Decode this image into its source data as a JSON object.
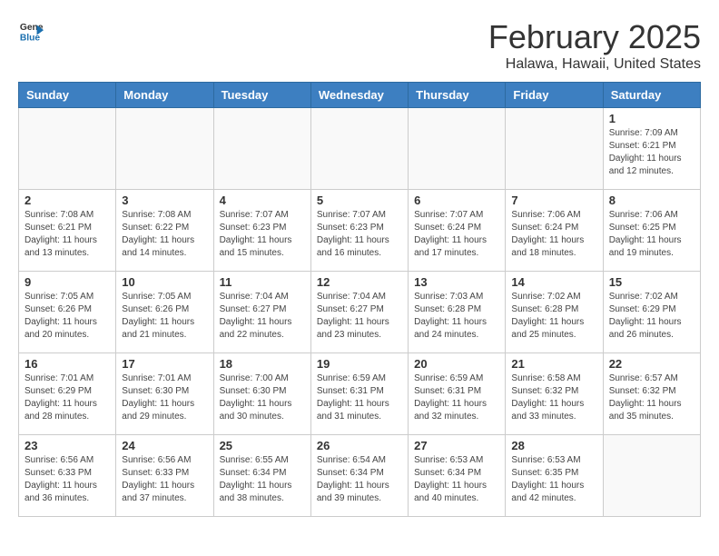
{
  "header": {
    "logo_general": "General",
    "logo_blue": "Blue",
    "title": "February 2025",
    "subtitle": "Halawa, Hawaii, United States"
  },
  "weekdays": [
    "Sunday",
    "Monday",
    "Tuesday",
    "Wednesday",
    "Thursday",
    "Friday",
    "Saturday"
  ],
  "weeks": [
    [
      {
        "day": "",
        "info": ""
      },
      {
        "day": "",
        "info": ""
      },
      {
        "day": "",
        "info": ""
      },
      {
        "day": "",
        "info": ""
      },
      {
        "day": "",
        "info": ""
      },
      {
        "day": "",
        "info": ""
      },
      {
        "day": "1",
        "info": "Sunrise: 7:09 AM\nSunset: 6:21 PM\nDaylight: 11 hours\nand 12 minutes."
      }
    ],
    [
      {
        "day": "2",
        "info": "Sunrise: 7:08 AM\nSunset: 6:21 PM\nDaylight: 11 hours\nand 13 minutes."
      },
      {
        "day": "3",
        "info": "Sunrise: 7:08 AM\nSunset: 6:22 PM\nDaylight: 11 hours\nand 14 minutes."
      },
      {
        "day": "4",
        "info": "Sunrise: 7:07 AM\nSunset: 6:23 PM\nDaylight: 11 hours\nand 15 minutes."
      },
      {
        "day": "5",
        "info": "Sunrise: 7:07 AM\nSunset: 6:23 PM\nDaylight: 11 hours\nand 16 minutes."
      },
      {
        "day": "6",
        "info": "Sunrise: 7:07 AM\nSunset: 6:24 PM\nDaylight: 11 hours\nand 17 minutes."
      },
      {
        "day": "7",
        "info": "Sunrise: 7:06 AM\nSunset: 6:24 PM\nDaylight: 11 hours\nand 18 minutes."
      },
      {
        "day": "8",
        "info": "Sunrise: 7:06 AM\nSunset: 6:25 PM\nDaylight: 11 hours\nand 19 minutes."
      }
    ],
    [
      {
        "day": "9",
        "info": "Sunrise: 7:05 AM\nSunset: 6:26 PM\nDaylight: 11 hours\nand 20 minutes."
      },
      {
        "day": "10",
        "info": "Sunrise: 7:05 AM\nSunset: 6:26 PM\nDaylight: 11 hours\nand 21 minutes."
      },
      {
        "day": "11",
        "info": "Sunrise: 7:04 AM\nSunset: 6:27 PM\nDaylight: 11 hours\nand 22 minutes."
      },
      {
        "day": "12",
        "info": "Sunrise: 7:04 AM\nSunset: 6:27 PM\nDaylight: 11 hours\nand 23 minutes."
      },
      {
        "day": "13",
        "info": "Sunrise: 7:03 AM\nSunset: 6:28 PM\nDaylight: 11 hours\nand 24 minutes."
      },
      {
        "day": "14",
        "info": "Sunrise: 7:02 AM\nSunset: 6:28 PM\nDaylight: 11 hours\nand 25 minutes."
      },
      {
        "day": "15",
        "info": "Sunrise: 7:02 AM\nSunset: 6:29 PM\nDaylight: 11 hours\nand 26 minutes."
      }
    ],
    [
      {
        "day": "16",
        "info": "Sunrise: 7:01 AM\nSunset: 6:29 PM\nDaylight: 11 hours\nand 28 minutes."
      },
      {
        "day": "17",
        "info": "Sunrise: 7:01 AM\nSunset: 6:30 PM\nDaylight: 11 hours\nand 29 minutes."
      },
      {
        "day": "18",
        "info": "Sunrise: 7:00 AM\nSunset: 6:30 PM\nDaylight: 11 hours\nand 30 minutes."
      },
      {
        "day": "19",
        "info": "Sunrise: 6:59 AM\nSunset: 6:31 PM\nDaylight: 11 hours\nand 31 minutes."
      },
      {
        "day": "20",
        "info": "Sunrise: 6:59 AM\nSunset: 6:31 PM\nDaylight: 11 hours\nand 32 minutes."
      },
      {
        "day": "21",
        "info": "Sunrise: 6:58 AM\nSunset: 6:32 PM\nDaylight: 11 hours\nand 33 minutes."
      },
      {
        "day": "22",
        "info": "Sunrise: 6:57 AM\nSunset: 6:32 PM\nDaylight: 11 hours\nand 35 minutes."
      }
    ],
    [
      {
        "day": "23",
        "info": "Sunrise: 6:56 AM\nSunset: 6:33 PM\nDaylight: 11 hours\nand 36 minutes."
      },
      {
        "day": "24",
        "info": "Sunrise: 6:56 AM\nSunset: 6:33 PM\nDaylight: 11 hours\nand 37 minutes."
      },
      {
        "day": "25",
        "info": "Sunrise: 6:55 AM\nSunset: 6:34 PM\nDaylight: 11 hours\nand 38 minutes."
      },
      {
        "day": "26",
        "info": "Sunrise: 6:54 AM\nSunset: 6:34 PM\nDaylight: 11 hours\nand 39 minutes."
      },
      {
        "day": "27",
        "info": "Sunrise: 6:53 AM\nSunset: 6:34 PM\nDaylight: 11 hours\nand 40 minutes."
      },
      {
        "day": "28",
        "info": "Sunrise: 6:53 AM\nSunset: 6:35 PM\nDaylight: 11 hours\nand 42 minutes."
      },
      {
        "day": "",
        "info": ""
      }
    ]
  ]
}
